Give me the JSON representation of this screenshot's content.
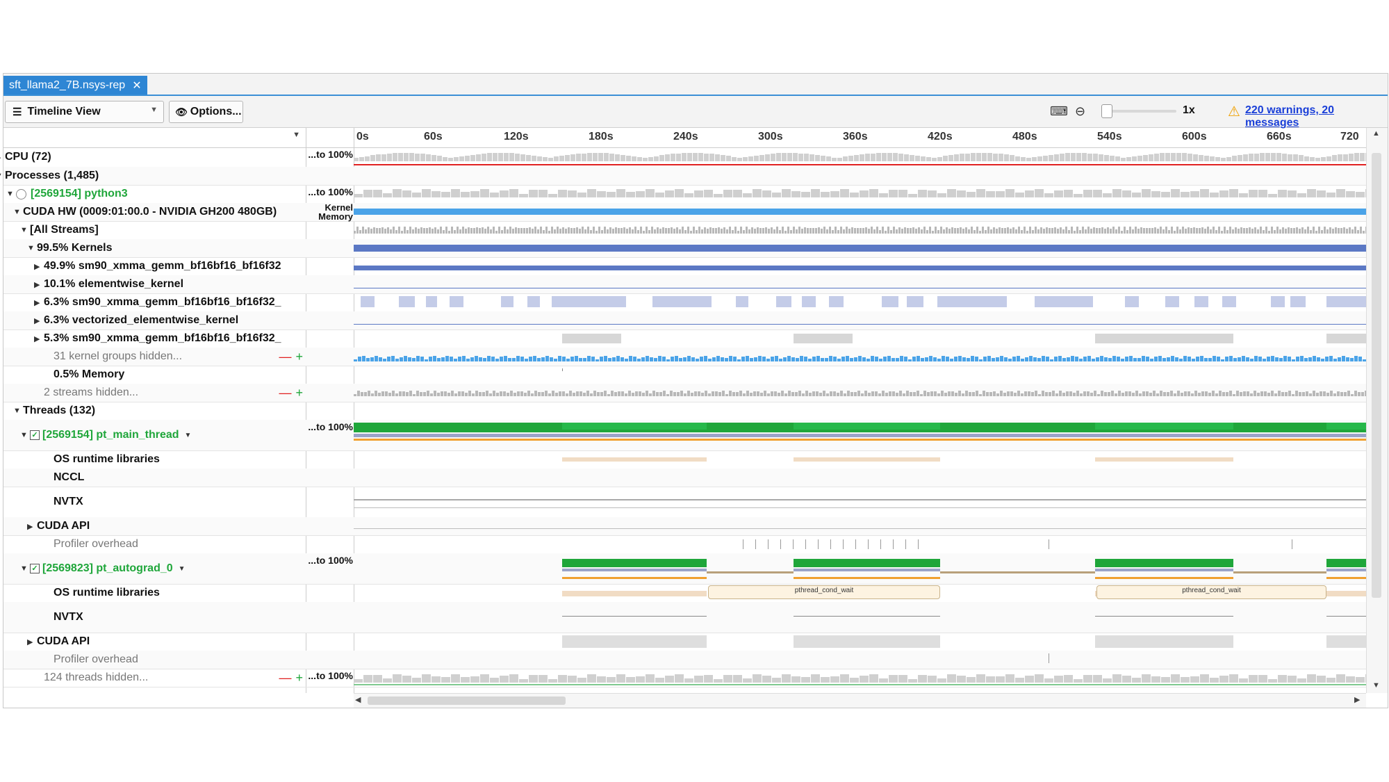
{
  "tab": {
    "title": "sft_llama2_7B.nsys-rep",
    "close": "✕"
  },
  "toolbar": {
    "view_label": "Timeline View",
    "options_label": "Options...",
    "zoom_level": "1x",
    "warnings": "220 warnings, 20 messages"
  },
  "axis": {
    "ticks": [
      "0s",
      "60s",
      "120s",
      "180s",
      "240s",
      "300s",
      "360s",
      "420s",
      "480s",
      "540s",
      "600s",
      "660s",
      "720"
    ]
  },
  "rows": [
    {
      "label": "CPU (72)",
      "mid": "...to 100%"
    },
    {
      "label": "Processes (1,485)",
      "mid": ""
    },
    {
      "label": "[2569154] python3",
      "mid": "...to 100%"
    },
    {
      "label": "CUDA HW (0009:01:00.0 - NVIDIA GH200 480GB)",
      "mid_top": "Kernel",
      "mid_bottom": "Memory"
    },
    {
      "label": "[All Streams]",
      "mid": ""
    },
    {
      "label": "99.5% Kernels",
      "mid": ""
    },
    {
      "label": "49.9% sm90_xmma_gemm_bf16bf16_bf16f32",
      "mid": ""
    },
    {
      "label": "10.1% elementwise_kernel",
      "mid": ""
    },
    {
      "label": "6.3% sm90_xmma_gemm_bf16bf16_bf16f32_",
      "mid": ""
    },
    {
      "label": "6.3% vectorized_elementwise_kernel",
      "mid": ""
    },
    {
      "label": "5.3% sm90_xmma_gemm_bf16bf16_bf16f32_",
      "mid": ""
    },
    {
      "label": "31 kernel groups hidden...",
      "mid": ""
    },
    {
      "label": "0.5% Memory",
      "mid": ""
    },
    {
      "label": "2 streams hidden...",
      "mid": ""
    },
    {
      "label": "Threads (132)",
      "mid": ""
    },
    {
      "label": "[2569154] pt_main_thread",
      "mid": "...to 100%"
    },
    {
      "label": "OS runtime libraries",
      "mid": ""
    },
    {
      "label": "NCCL",
      "mid": ""
    },
    {
      "label": "NVTX",
      "mid": ""
    },
    {
      "label": "CUDA API",
      "mid": ""
    },
    {
      "label": "Profiler overhead",
      "mid": ""
    },
    {
      "label": "[2569823] pt_autograd_0",
      "mid": "...to 100%"
    },
    {
      "label": "OS runtime libraries",
      "mid": ""
    },
    {
      "label": "NVTX",
      "mid": ""
    },
    {
      "label": "CUDA API",
      "mid": ""
    },
    {
      "label": "Profiler overhead",
      "mid": ""
    },
    {
      "label": "124 threads hidden...",
      "mid": "...to 100%"
    }
  ],
  "pthread": {
    "label_1": "pthread_cond_wait",
    "label_2": "pthread_cond_wait"
  },
  "hidden_controls": {
    "minus": "—",
    "plus": "+"
  },
  "colors": {
    "accent": "#2e86d4",
    "green": "#1fa63a",
    "kernel_blue": "#5b78c4",
    "memory_blue": "#4aa3e8",
    "warn": "#f0a000"
  }
}
